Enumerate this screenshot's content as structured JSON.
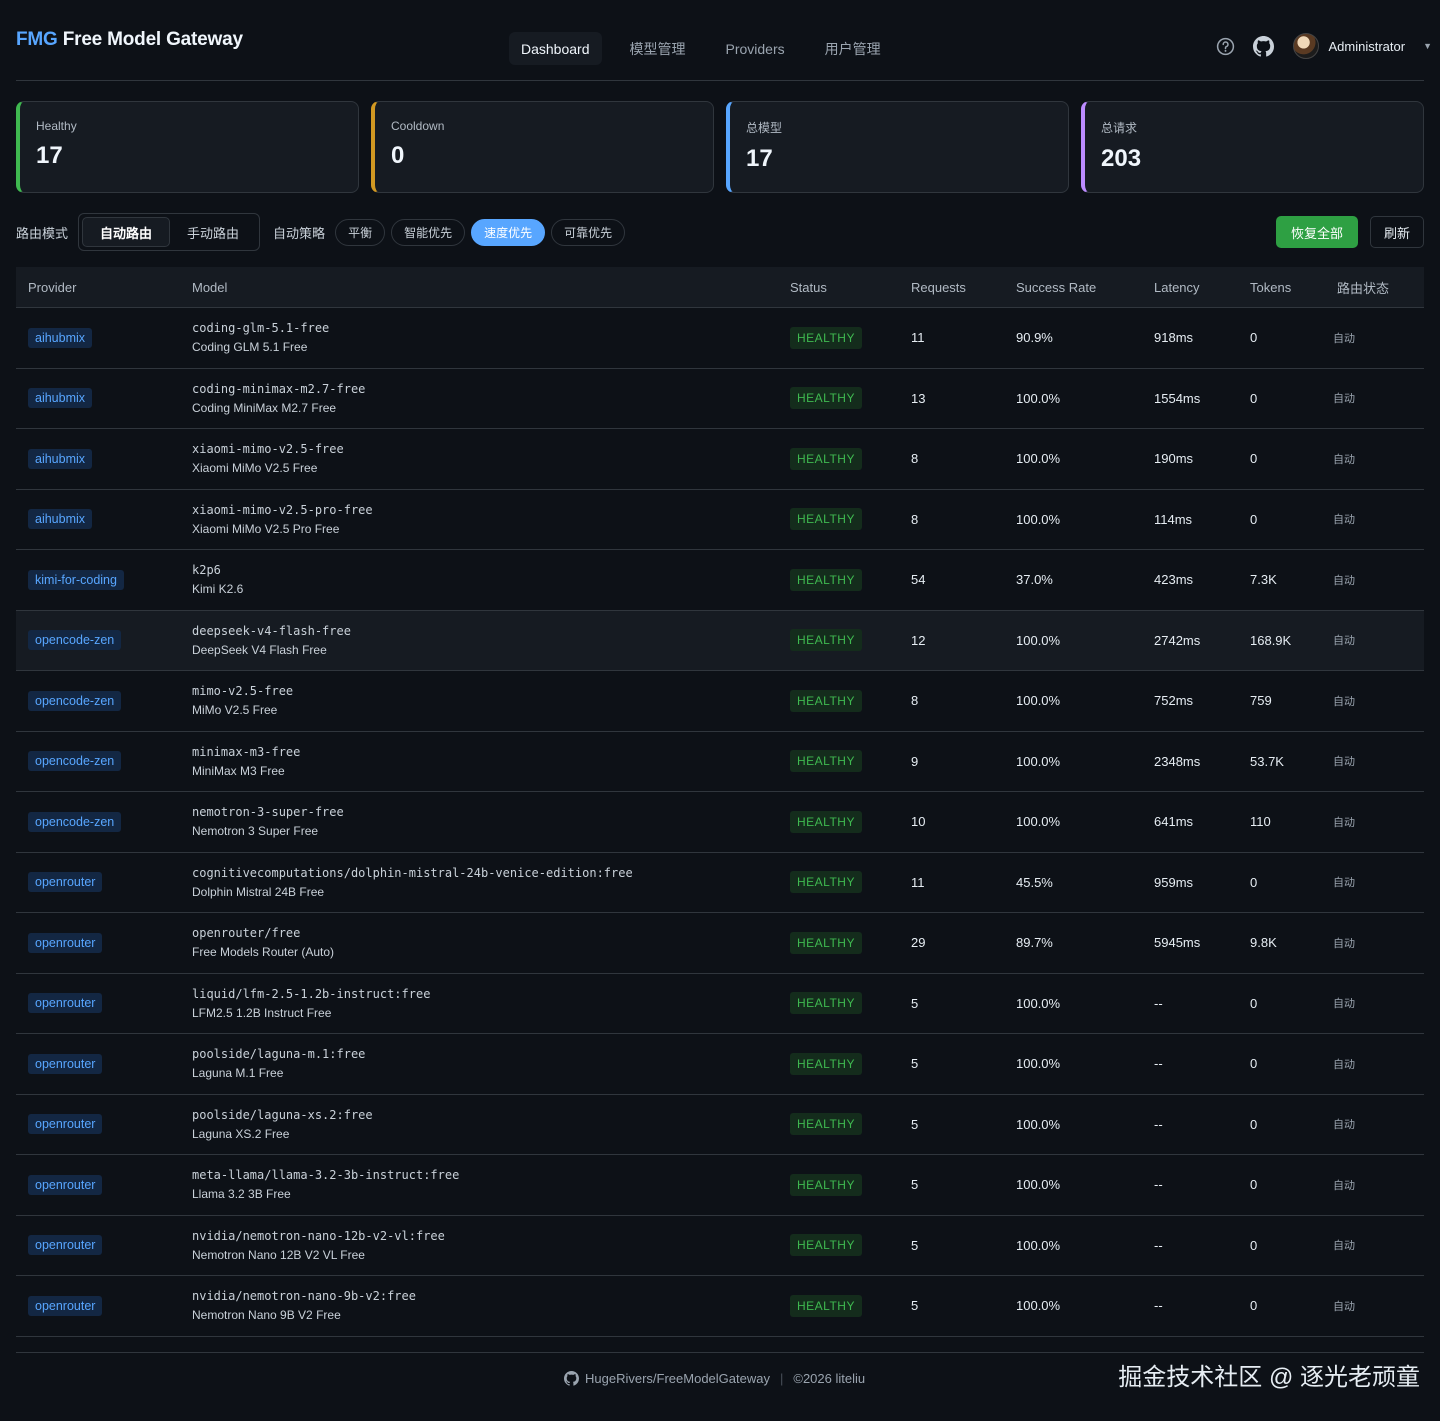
{
  "brand": {
    "prefix": "FMG",
    "name": "Free Model Gateway"
  },
  "nav": [
    {
      "label": "Dashboard",
      "active": true
    },
    {
      "label": "模型管理",
      "active": false
    },
    {
      "label": "Providers",
      "active": false
    },
    {
      "label": "用户管理",
      "active": false
    }
  ],
  "user": {
    "name": "Administrator"
  },
  "icons": {
    "help": "help-circle-icon",
    "github": "github-icon",
    "caret": "chevron-down-icon"
  },
  "stats": [
    {
      "label": "Healthy",
      "value": "17",
      "color": "#3fb950"
    },
    {
      "label": "Cooldown",
      "value": "0",
      "color": "#d29922"
    },
    {
      "label": "总模型",
      "value": "17",
      "color": "#58a6ff"
    },
    {
      "label": "总请求",
      "value": "203",
      "color": "#bc8cff"
    }
  ],
  "toolbar": {
    "route_mode_label": "路由模式",
    "route_modes": [
      {
        "label": "自动路由",
        "active": true
      },
      {
        "label": "手动路由",
        "active": false
      }
    ],
    "strategy_label": "自动策略",
    "strategies": [
      {
        "label": "平衡",
        "active": false
      },
      {
        "label": "智能优先",
        "active": false
      },
      {
        "label": "速度优先",
        "active": true
      },
      {
        "label": "可靠优先",
        "active": false
      }
    ],
    "restore_all": "恢复全部",
    "refresh": "刷新"
  },
  "table": {
    "headers": [
      "Provider",
      "Model",
      "Status",
      "Requests",
      "Success Rate",
      "Latency",
      "Tokens",
      "路由状态"
    ],
    "rows": [
      {
        "provider": "aihubmix",
        "model_id": "coding-glm-5.1-free",
        "model_name": "Coding GLM 5.1 Free",
        "status": "HEALTHY",
        "requests": "11",
        "success_rate": "90.9%",
        "latency": "918ms",
        "tokens": "0",
        "route": "自动"
      },
      {
        "provider": "aihubmix",
        "model_id": "coding-minimax-m2.7-free",
        "model_name": "Coding MiniMax M2.7 Free",
        "status": "HEALTHY",
        "requests": "13",
        "success_rate": "100.0%",
        "latency": "1554ms",
        "tokens": "0",
        "route": "自动"
      },
      {
        "provider": "aihubmix",
        "model_id": "xiaomi-mimo-v2.5-free",
        "model_name": "Xiaomi MiMo V2.5 Free",
        "status": "HEALTHY",
        "requests": "8",
        "success_rate": "100.0%",
        "latency": "190ms",
        "tokens": "0",
        "route": "自动"
      },
      {
        "provider": "aihubmix",
        "model_id": "xiaomi-mimo-v2.5-pro-free",
        "model_name": "Xiaomi MiMo V2.5 Pro Free",
        "status": "HEALTHY",
        "requests": "8",
        "success_rate": "100.0%",
        "latency": "114ms",
        "tokens": "0",
        "route": "自动"
      },
      {
        "provider": "kimi-for-coding",
        "model_id": "k2p6",
        "model_name": "Kimi K2.6",
        "status": "HEALTHY",
        "requests": "54",
        "success_rate": "37.0%",
        "latency": "423ms",
        "tokens": "7.3K",
        "route": "自动"
      },
      {
        "provider": "opencode-zen",
        "model_id": "deepseek-v4-flash-free",
        "model_name": "DeepSeek V4 Flash Free",
        "status": "HEALTHY",
        "requests": "12",
        "success_rate": "100.0%",
        "latency": "2742ms",
        "tokens": "168.9K",
        "route": "自动"
      },
      {
        "provider": "opencode-zen",
        "model_id": "mimo-v2.5-free",
        "model_name": "MiMo V2.5 Free",
        "status": "HEALTHY",
        "requests": "8",
        "success_rate": "100.0%",
        "latency": "752ms",
        "tokens": "759",
        "route": "自动"
      },
      {
        "provider": "opencode-zen",
        "model_id": "minimax-m3-free",
        "model_name": "MiniMax M3 Free",
        "status": "HEALTHY",
        "requests": "9",
        "success_rate": "100.0%",
        "latency": "2348ms",
        "tokens": "53.7K",
        "route": "自动"
      },
      {
        "provider": "opencode-zen",
        "model_id": "nemotron-3-super-free",
        "model_name": "Nemotron 3 Super Free",
        "status": "HEALTHY",
        "requests": "10",
        "success_rate": "100.0%",
        "latency": "641ms",
        "tokens": "110",
        "route": "自动"
      },
      {
        "provider": "openrouter",
        "model_id": "cognitivecomputations/dolphin-mistral-24b-venice-edition:free",
        "model_name": "Dolphin Mistral 24B Free",
        "status": "HEALTHY",
        "requests": "11",
        "success_rate": "45.5%",
        "latency": "959ms",
        "tokens": "0",
        "route": "自动"
      },
      {
        "provider": "openrouter",
        "model_id": "openrouter/free",
        "model_name": "Free Models Router (Auto)",
        "status": "HEALTHY",
        "requests": "29",
        "success_rate": "89.7%",
        "latency": "5945ms",
        "tokens": "9.8K",
        "route": "自动"
      },
      {
        "provider": "openrouter",
        "model_id": "liquid/lfm-2.5-1.2b-instruct:free",
        "model_name": "LFM2.5 1.2B Instruct Free",
        "status": "HEALTHY",
        "requests": "5",
        "success_rate": "100.0%",
        "latency": "--",
        "tokens": "0",
        "route": "自动"
      },
      {
        "provider": "openrouter",
        "model_id": "poolside/laguna-m.1:free",
        "model_name": "Laguna M.1 Free",
        "status": "HEALTHY",
        "requests": "5",
        "success_rate": "100.0%",
        "latency": "--",
        "tokens": "0",
        "route": "自动"
      },
      {
        "provider": "openrouter",
        "model_id": "poolside/laguna-xs.2:free",
        "model_name": "Laguna XS.2 Free",
        "status": "HEALTHY",
        "requests": "5",
        "success_rate": "100.0%",
        "latency": "--",
        "tokens": "0",
        "route": "自动"
      },
      {
        "provider": "openrouter",
        "model_id": "meta-llama/llama-3.2-3b-instruct:free",
        "model_name": "Llama 3.2 3B Free",
        "status": "HEALTHY",
        "requests": "5",
        "success_rate": "100.0%",
        "latency": "--",
        "tokens": "0",
        "route": "自动"
      },
      {
        "provider": "openrouter",
        "model_id": "nvidia/nemotron-nano-12b-v2-vl:free",
        "model_name": "Nemotron Nano 12B V2 VL Free",
        "status": "HEALTHY",
        "requests": "5",
        "success_rate": "100.0%",
        "latency": "--",
        "tokens": "0",
        "route": "自动"
      },
      {
        "provider": "openrouter",
        "model_id": "nvidia/nemotron-nano-9b-v2:free",
        "model_name": "Nemotron Nano 9B V2 Free",
        "status": "HEALTHY",
        "requests": "5",
        "success_rate": "100.0%",
        "latency": "--",
        "tokens": "0",
        "route": "自动"
      }
    ]
  },
  "footer": {
    "repo": "HugeRivers/FreeModelGateway",
    "copyright": "©2026 liteliu",
    "watermark": "掘金技术社区 @ 逐光老顽童"
  }
}
